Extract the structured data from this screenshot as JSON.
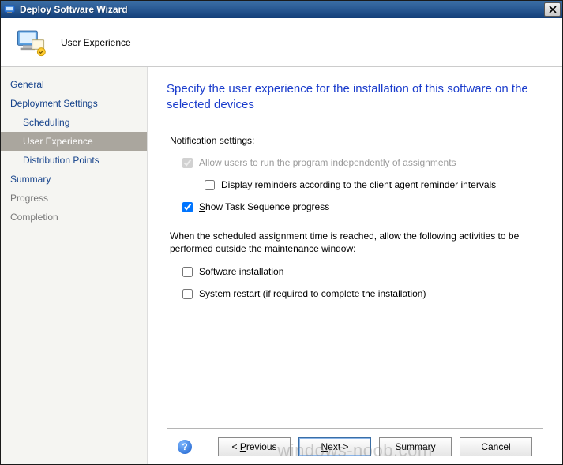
{
  "window": {
    "title": "Deploy Software Wizard"
  },
  "header": {
    "step_title": "User Experience"
  },
  "sidebar": {
    "items": [
      {
        "label": "General",
        "indent": 0,
        "active": false,
        "pending": false
      },
      {
        "label": "Deployment Settings",
        "indent": 0,
        "active": false,
        "pending": false
      },
      {
        "label": "Scheduling",
        "indent": 1,
        "active": false,
        "pending": false
      },
      {
        "label": "User Experience",
        "indent": 1,
        "active": true,
        "pending": false
      },
      {
        "label": "Distribution Points",
        "indent": 1,
        "active": false,
        "pending": false
      },
      {
        "label": "Summary",
        "indent": 0,
        "active": false,
        "pending": false
      },
      {
        "label": "Progress",
        "indent": 0,
        "active": false,
        "pending": true
      },
      {
        "label": "Completion",
        "indent": 0,
        "active": false,
        "pending": true
      }
    ]
  },
  "content": {
    "heading": "Specify the user experience for the installation of this software on the selected devices",
    "notification_label": "Notification settings:",
    "allow_users": {
      "label": "Allow users to run the program independently of assignments",
      "checked": true,
      "disabled": true
    },
    "display_reminders": {
      "label": "Display reminders according to the client agent reminder intervals",
      "checked": false,
      "disabled": false
    },
    "show_ts_progress": {
      "label": "Show Task Sequence progress",
      "checked": true,
      "disabled": false
    },
    "maintenance_paragraph": "When the scheduled assignment time is reached, allow the following activities to be performed outside the maintenance window:",
    "software_install": {
      "label": "Software installation",
      "checked": false,
      "disabled": false
    },
    "system_restart": {
      "label": "System restart (if required to complete the installation)",
      "checked": false,
      "disabled": false
    }
  },
  "footer": {
    "previous": "< Previous",
    "next": "Next >",
    "summary": "Summary",
    "cancel": "Cancel"
  },
  "watermark": "windows-noob.com"
}
